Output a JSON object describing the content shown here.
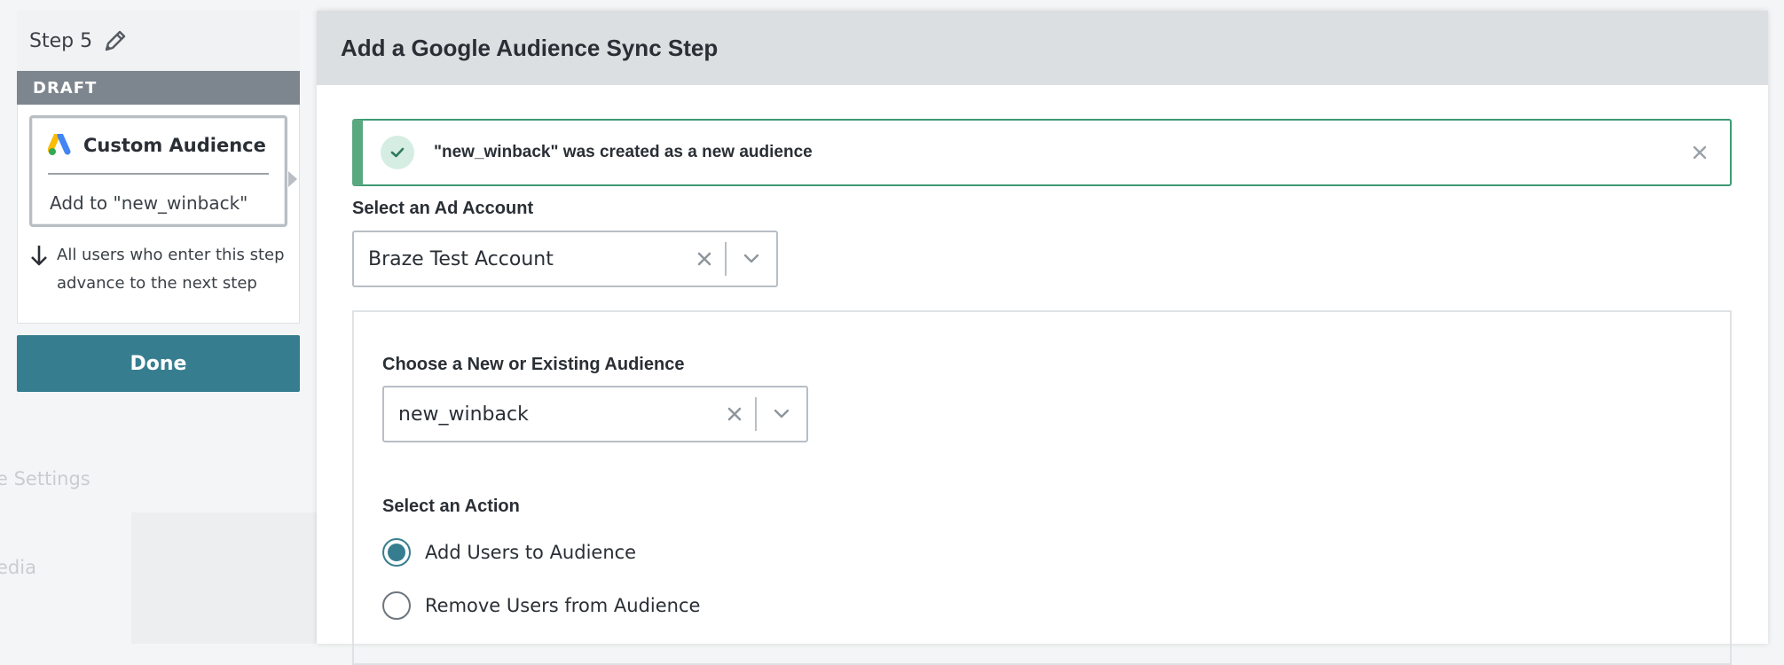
{
  "background": {
    "settings_text": "e Settings",
    "media_text": "edia"
  },
  "step": {
    "title": "Step 5",
    "status": "DRAFT",
    "card_title": "Custom Audience",
    "card_subtitle": "Add to \"new_winback\"",
    "advance_text": "All users who enter this step advance to the next step",
    "done_label": "Done"
  },
  "modal": {
    "title": "Add a Google Audience Sync Step",
    "alert_text": "\"new_winback\" was created as a new audience",
    "ad_account": {
      "label": "Select an Ad Account",
      "value": "Braze Test Account"
    },
    "audience": {
      "label": "Choose a New or Existing Audience",
      "value": "new_winback"
    },
    "action": {
      "label": "Select an Action",
      "options": [
        {
          "label": "Add Users to Audience",
          "selected": true
        },
        {
          "label": "Remove Users from Audience",
          "selected": false
        }
      ]
    }
  },
  "colors": {
    "accent": "#367e8f",
    "success_border": "#3e9a74",
    "draft_bar": "#7d868e"
  },
  "icons": {
    "edit": "pencil-icon",
    "logo": "google-ads-icon",
    "advance": "arrow-down-icon",
    "success": "check-icon",
    "close": "close-icon",
    "clear": "clear-x-icon",
    "dropdown": "chevron-down-icon"
  }
}
